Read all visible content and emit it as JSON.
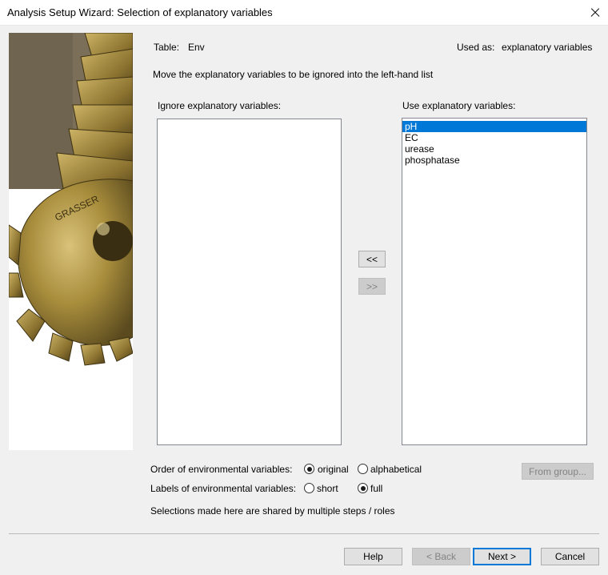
{
  "window": {
    "title": "Analysis Setup Wizard: Selection of explanatory variables"
  },
  "header": {
    "table_label": "Table:",
    "table_value": "Env",
    "used_as_label": "Used as:",
    "used_as_value": "explanatory variables",
    "instruction": "Move the explanatory variables to be ignored into the left-hand list"
  },
  "ignore_list": {
    "label": "Ignore explanatory variables:",
    "items": []
  },
  "use_list": {
    "label": "Use explanatory variables:",
    "items": [
      "pH",
      "EC",
      "urease",
      "phosphatase"
    ],
    "selected_index": 0
  },
  "move_buttons": {
    "move_left": "<<",
    "move_right": ">>"
  },
  "options": {
    "order_label": "Order of environmental variables:",
    "order_options": [
      "original",
      "alphabetical"
    ],
    "order_selected": "original",
    "labels_label": "Labels of environmental variables:",
    "labels_options": [
      "short",
      "full"
    ],
    "labels_selected": "full",
    "from_group": "From group...",
    "note": "Selections made here are shared by multiple steps / roles"
  },
  "footer": {
    "help": "Help",
    "back": "< Back",
    "next": "Next >",
    "cancel": "Cancel"
  },
  "colors": {
    "selection": "#0078d7",
    "dialog_bg": "#f0f0f0",
    "gold": "#a88d3c"
  },
  "icons": {
    "close": "close-icon",
    "side_image": "wizard-side-image"
  }
}
